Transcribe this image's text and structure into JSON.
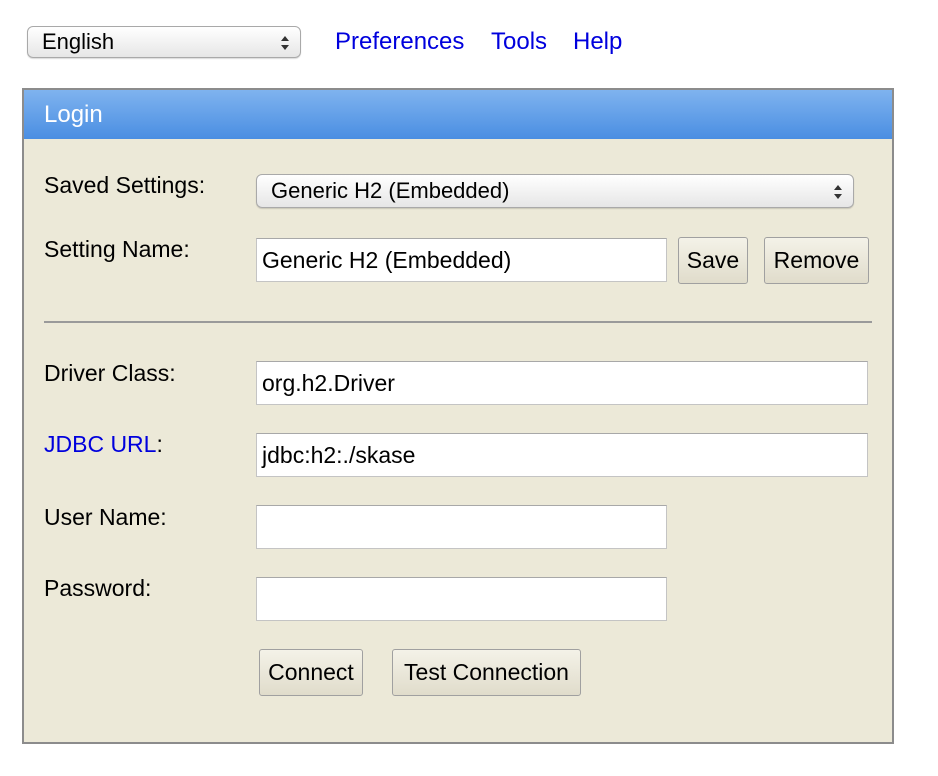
{
  "topbar": {
    "language": "English",
    "links": [
      "Preferences",
      "Tools",
      "Help"
    ]
  },
  "panel": {
    "title": "Login",
    "saved_settings_label": "Saved Settings:",
    "saved_settings_value": "Generic H2 (Embedded)",
    "setting_name_label": "Setting Name:",
    "setting_name_value": "Generic H2 (Embedded)",
    "save_label": "Save",
    "remove_label": "Remove",
    "driver_class_label": "Driver Class:",
    "driver_class_value": "org.h2.Driver",
    "jdbc_url_link": "JDBC URL",
    "jdbc_url_colon": ":",
    "jdbc_url_value": "jdbc:h2:./skase",
    "user_name_label": "User Name:",
    "user_name_value": "",
    "password_label": "Password:",
    "password_value": "",
    "connect_label": "Connect",
    "test_connection_label": "Test Connection"
  },
  "colors": {
    "link": "#0000dd",
    "panel_background": "#ece9d8",
    "header_gradient_top": "#7fb3ef",
    "header_gradient_bottom": "#4a8ee2",
    "header_text": "#ffffff"
  },
  "icons": {
    "select_arrows": "up-down-chevron-icon"
  }
}
